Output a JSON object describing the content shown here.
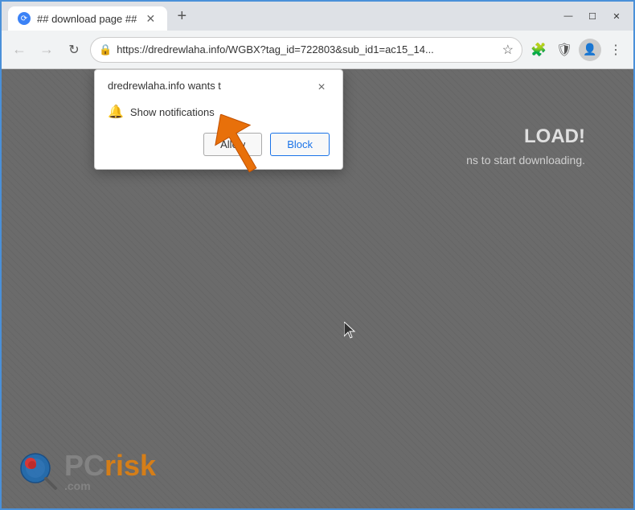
{
  "browser": {
    "tab": {
      "title": "## download page ##",
      "favicon": "globe"
    },
    "new_tab_label": "+",
    "window_controls": {
      "minimize": "—",
      "maximize": "☐",
      "close": "✕"
    },
    "address_bar": {
      "url": "https://dredrewlaha.info/WGBX?tag_id=722803&sub_id1=ac15_14...",
      "lock_icon": "🔒"
    }
  },
  "popup": {
    "title": "dredrewlaha.info wants t",
    "close_label": "×",
    "notification_row": {
      "icon": "🔔",
      "label": "Show notifications"
    },
    "buttons": {
      "allow": "Allow",
      "block": "Block"
    }
  },
  "page": {
    "main_text": "LOAD!",
    "sub_text": "ns to start downloading."
  },
  "watermark": {
    "site": "PCrisk.com"
  }
}
